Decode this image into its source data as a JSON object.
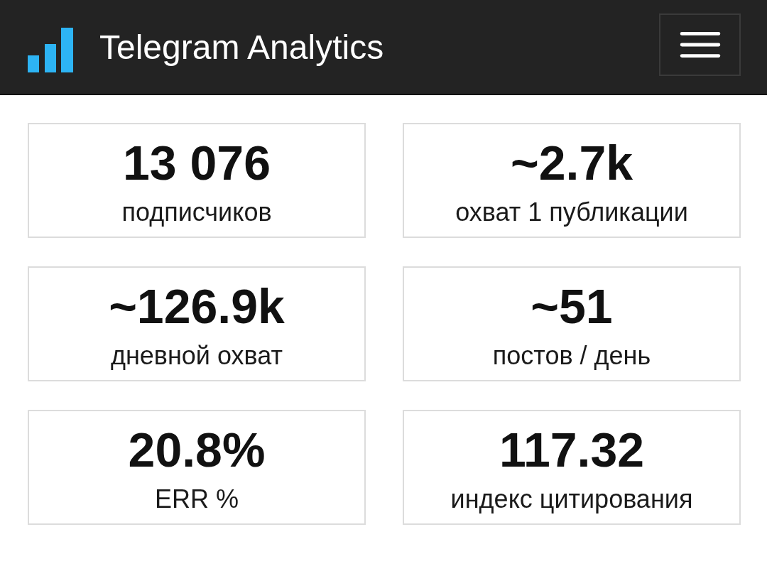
{
  "header": {
    "title": "Telegram Analytics"
  },
  "stats": [
    {
      "value": "13 076",
      "label": "подписчиков"
    },
    {
      "value": "~2.7k",
      "label": "охват 1 публикации"
    },
    {
      "value": "~126.9k",
      "label": "дневной охват"
    },
    {
      "value": "~51",
      "label": "постов / день"
    },
    {
      "value": "20.8%",
      "label": "ERR %"
    },
    {
      "value": "117.32",
      "label": "индекс цитирования"
    }
  ]
}
